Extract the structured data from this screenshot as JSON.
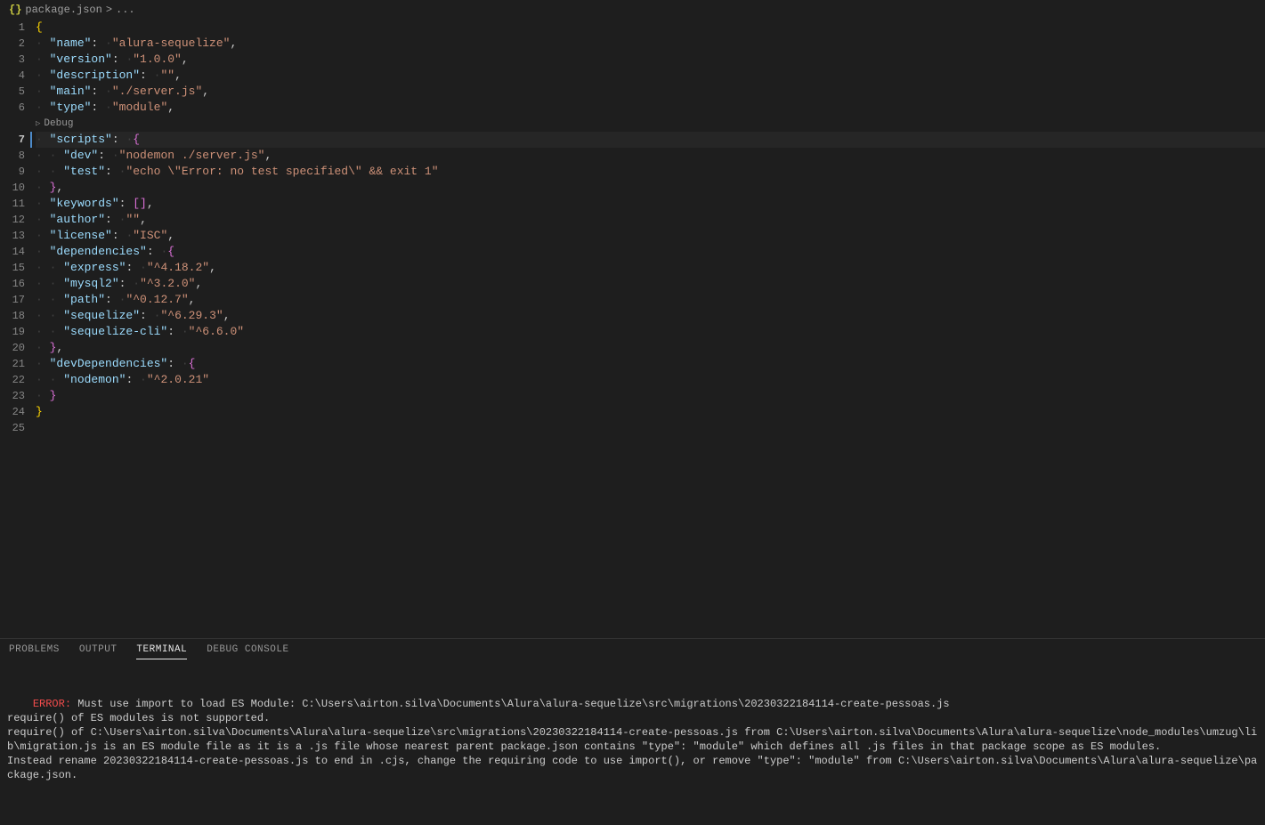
{
  "breadcrumb": {
    "icon": "{}",
    "file": "package.json",
    "sep": ">",
    "tail": "..."
  },
  "codelens": {
    "label": "Debug"
  },
  "code": {
    "lines": [
      {
        "n": 1,
        "ind": 0,
        "t": "brace-open"
      },
      {
        "n": 2,
        "ind": 1,
        "t": "kv",
        "key": "name",
        "val": "alura-sequelize",
        "comma": true
      },
      {
        "n": 3,
        "ind": 1,
        "t": "kv",
        "key": "version",
        "val": "1.0.0",
        "comma": true
      },
      {
        "n": 4,
        "ind": 1,
        "t": "kv",
        "key": "description",
        "val": "",
        "comma": true
      },
      {
        "n": 5,
        "ind": 1,
        "t": "kv",
        "key": "main",
        "val": "./server.js",
        "comma": true
      },
      {
        "n": 6,
        "ind": 1,
        "t": "kv",
        "key": "type",
        "val": "module",
        "comma": true
      },
      {
        "n": 7,
        "ind": 1,
        "t": "kobj",
        "key": "scripts",
        "active": true
      },
      {
        "n": 8,
        "ind": 2,
        "t": "kv",
        "key": "dev",
        "val": "nodemon ./server.js",
        "comma": true
      },
      {
        "n": 9,
        "ind": 2,
        "t": "kv",
        "key": "test",
        "val": "echo \\\"Error: no test specified\\\" && exit 1"
      },
      {
        "n": 10,
        "ind": 1,
        "t": "brace-close2",
        "comma": true
      },
      {
        "n": 11,
        "ind": 1,
        "t": "karr",
        "key": "keywords",
        "comma": true
      },
      {
        "n": 12,
        "ind": 1,
        "t": "kv",
        "key": "author",
        "val": "",
        "comma": true
      },
      {
        "n": 13,
        "ind": 1,
        "t": "kv",
        "key": "license",
        "val": "ISC",
        "comma": true
      },
      {
        "n": 14,
        "ind": 1,
        "t": "kobj",
        "key": "dependencies"
      },
      {
        "n": 15,
        "ind": 2,
        "t": "kv",
        "key": "express",
        "val": "^4.18.2",
        "comma": true
      },
      {
        "n": 16,
        "ind": 2,
        "t": "kv",
        "key": "mysql2",
        "val": "^3.2.0",
        "comma": true
      },
      {
        "n": 17,
        "ind": 2,
        "t": "kv",
        "key": "path",
        "val": "^0.12.7",
        "comma": true
      },
      {
        "n": 18,
        "ind": 2,
        "t": "kv",
        "key": "sequelize",
        "val": "^6.29.3",
        "comma": true
      },
      {
        "n": 19,
        "ind": 2,
        "t": "kv",
        "key": "sequelize-cli",
        "val": "^6.6.0"
      },
      {
        "n": 20,
        "ind": 1,
        "t": "brace-close2",
        "comma": true
      },
      {
        "n": 21,
        "ind": 1,
        "t": "kobj",
        "key": "devDependencies"
      },
      {
        "n": 22,
        "ind": 2,
        "t": "kv",
        "key": "nodemon",
        "val": "^2.0.21"
      },
      {
        "n": 23,
        "ind": 1,
        "t": "brace-close2"
      },
      {
        "n": 24,
        "ind": 0,
        "t": "brace-close"
      },
      {
        "n": 25,
        "ind": 0,
        "t": "empty"
      }
    ]
  },
  "panel": {
    "tabs": [
      {
        "label": "PROBLEMS",
        "active": false
      },
      {
        "label": "OUTPUT",
        "active": false
      },
      {
        "label": "TERMINAL",
        "active": true
      },
      {
        "label": "DEBUG CONSOLE",
        "active": false
      }
    ],
    "terminal": {
      "error_prefix": "ERROR:",
      "error_line": " Must use import to load ES Module: C:\\Users\\airton.silva\\Documents\\Alura\\alura-sequelize\\src\\migrations\\20230322184114-create-pessoas.js",
      "body": "require() of ES modules is not supported.\nrequire() of C:\\Users\\airton.silva\\Documents\\Alura\\alura-sequelize\\src\\migrations\\20230322184114-create-pessoas.js from C:\\Users\\airton.silva\\Documents\\Alura\\alura-sequelize\\node_modules\\umzug\\lib\\migration.js is an ES module file as it is a .js file whose nearest parent package.json contains \"type\": \"module\" which defines all .js files in that package scope as ES modules.\nInstead rename 20230322184114-create-pessoas.js to end in .cjs, change the requiring code to use import(), or remove \"type\": \"module\" from C:\\Users\\airton.silva\\Documents\\Alura\\alura-sequelize\\package.json.\n"
    }
  }
}
